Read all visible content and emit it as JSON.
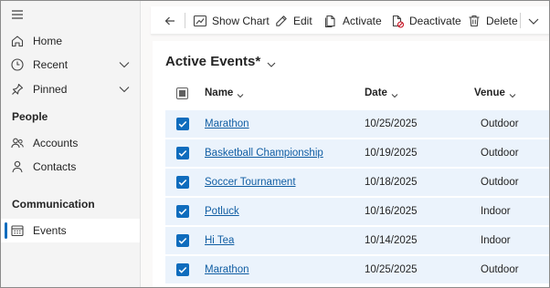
{
  "sidebar": {
    "nav": [
      {
        "label": "Home",
        "icon": "home-icon"
      },
      {
        "label": "Recent",
        "icon": "clock-icon",
        "expandable": true
      },
      {
        "label": "Pinned",
        "icon": "pin-icon",
        "expandable": true
      }
    ],
    "groups": [
      {
        "label": "People",
        "items": [
          {
            "label": "Accounts",
            "icon": "people-icon"
          },
          {
            "label": "Contacts",
            "icon": "person-icon"
          }
        ]
      },
      {
        "label": "Communication",
        "items": [
          {
            "label": "Events",
            "icon": "calendar-icon",
            "selected": true
          }
        ]
      }
    ]
  },
  "toolbar": {
    "back_icon": "back-arrow-icon",
    "show_chart_label": "Show Chart",
    "edit_label": "Edit",
    "activate_label": "Activate",
    "deactivate_label": "Deactivate",
    "delete_label": "Delete",
    "overflow_icon": "chevron-down-icon"
  },
  "view": {
    "title": "Active Events*",
    "columns": {
      "name": "Name",
      "date": "Date",
      "venue": "Venue"
    },
    "rows": [
      {
        "name": "Marathon",
        "date": "10/25/2025",
        "venue": "Outdoor",
        "selected": true
      },
      {
        "name": "Basketball Championship",
        "date": "10/19/2025",
        "venue": "Outdoor",
        "selected": true
      },
      {
        "name": "Soccer Tournament",
        "date": "10/18/2025",
        "venue": "Outdoor",
        "selected": true
      },
      {
        "name": "Potluck",
        "date": "10/16/2025",
        "venue": "Indoor",
        "selected": true
      },
      {
        "name": "Hi Tea",
        "date": "10/14/2025",
        "venue": "Indoor",
        "selected": true
      },
      {
        "name": "Marathon",
        "date": "10/25/2025",
        "venue": "Outdoor",
        "selected": true
      }
    ]
  },
  "colors": {
    "accent": "#0f6cbd",
    "link": "#115ea3",
    "row_selected_bg": "#ebf3fc",
    "sidebar_bg": "#f4f4f4"
  }
}
